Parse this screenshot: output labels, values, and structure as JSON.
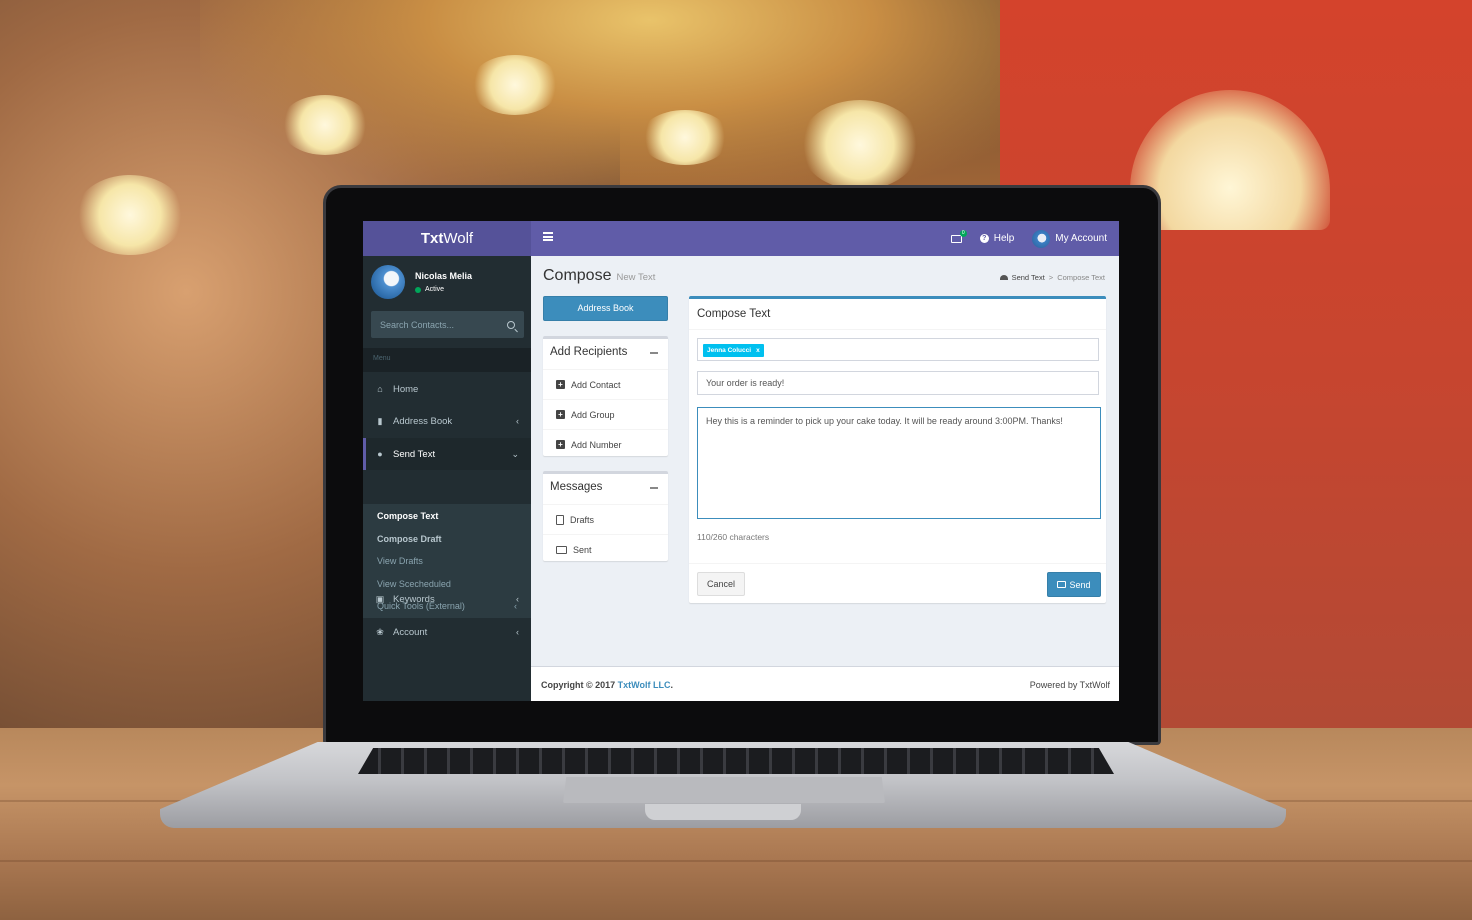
{
  "app": {
    "brand_bold": "Txt",
    "brand_light": "Wolf"
  },
  "topbar": {
    "mail_count": "0",
    "help_label": "Help",
    "account_label": "My Account"
  },
  "user": {
    "name": "Nicolas Melia",
    "status": "Active"
  },
  "sidebar": {
    "search_placeholder": "Search Contacts...",
    "menu_header": "Menu",
    "items": [
      {
        "label": "Home",
        "icon": "home-icon"
      },
      {
        "label": "Address Book",
        "icon": "book-icon"
      },
      {
        "label": "Send Text",
        "icon": "comment-icon"
      },
      {
        "label": "Keywords",
        "icon": "inbox-icon"
      },
      {
        "label": "Account",
        "icon": "paw-icon"
      }
    ],
    "submenu": [
      {
        "label": "Compose Text"
      },
      {
        "label": "Compose Draft"
      },
      {
        "label": "View Drafts"
      },
      {
        "label": "View Scecheduled"
      },
      {
        "label": "Quick Tools (External)"
      }
    ]
  },
  "page": {
    "title": "Compose",
    "subtitle": "New Text",
    "breadcrumb": [
      "Send Text",
      "Compose Text"
    ]
  },
  "address_book_button": "Address Book",
  "recipients_box": {
    "title": "Add Recipients",
    "links": [
      "Add Contact",
      "Add Group",
      "Add Number"
    ]
  },
  "messages_box": {
    "title": "Messages",
    "links": [
      "Drafts",
      "Sent"
    ]
  },
  "compose": {
    "title": "Compose Text",
    "recipient_tag": "Jenna Colucci",
    "tag_remove": "x",
    "subject_value": "Your order is ready!",
    "message_value": "Hey this is a reminder to pick up your cake today. It will be ready around 3:00PM. Thanks!",
    "char_count": "110/260 characters",
    "cancel_label": "Cancel",
    "send_label": "Send"
  },
  "footer": {
    "copyright_prefix": "Copyright © 2017 ",
    "company": "TxtWolf LLC",
    "suffix": ".",
    "powered": "Powered by TxtWolf"
  },
  "colors": {
    "topbar": "#605ca8",
    "brand_bg": "#555299",
    "sidebar": "#222d32",
    "primary": "#3c8dbc",
    "tag": "#00c0ef",
    "status_green": "#00a65a"
  }
}
